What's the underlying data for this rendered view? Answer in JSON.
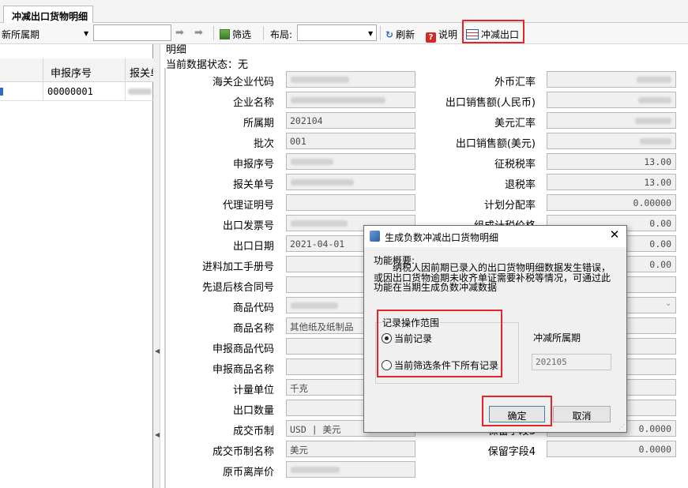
{
  "tab": {
    "label": "冲减出口货物明细"
  },
  "toolbar": {
    "period_label": "所属期",
    "period_value": "",
    "filter_input_value": "",
    "filter_label": "筛选",
    "layout_label": "布局:",
    "layout_value": "",
    "refresh_label": "刷新",
    "help_label": "说明",
    "offset_export_label": "冲减出口"
  },
  "grid": {
    "columns": [
      "申报序号",
      "报关单"
    ],
    "rows": [
      {
        "seq": "00000001"
      }
    ]
  },
  "form": {
    "section_title": "明细",
    "status_label": "当前数据状态：无",
    "left_fields": [
      {
        "label": "海关企业代码",
        "value": ""
      },
      {
        "label": "企业名称",
        "value": ""
      },
      {
        "label": "所属期",
        "value": "202104"
      },
      {
        "label": "批次",
        "value": "001"
      },
      {
        "label": "申报序号",
        "value": ""
      },
      {
        "label": "报关单号",
        "value": ""
      },
      {
        "label": "代理证明号",
        "value": ""
      },
      {
        "label": "出口发票号",
        "value": ""
      },
      {
        "label": "出口日期",
        "value": "2021-04-01"
      },
      {
        "label": "进料加工手册号",
        "value": ""
      },
      {
        "label": "先退后核合同号",
        "value": ""
      },
      {
        "label": "商品代码",
        "value": ""
      },
      {
        "label": "商品名称",
        "value": "其他纸及纸制品"
      },
      {
        "label": "申报商品代码",
        "value": ""
      },
      {
        "label": "申报商品名称",
        "value": ""
      },
      {
        "label": "计量单位",
        "value": "千克"
      },
      {
        "label": "出口数量",
        "value": ""
      },
      {
        "label": "成交币制",
        "value": "USD | 美元"
      },
      {
        "label": "成交币制名称",
        "value": "美元"
      },
      {
        "label": "原币离岸价",
        "value": ""
      }
    ],
    "right_fields": [
      {
        "label": "外币汇率",
        "value": ""
      },
      {
        "label": "出口销售额(人民币)",
        "value": ""
      },
      {
        "label": "美元汇率",
        "value": ""
      },
      {
        "label": "出口销售额(美元)",
        "value": ""
      },
      {
        "label": "征税税率",
        "value": "13.00"
      },
      {
        "label": "退税率",
        "value": "13.00"
      },
      {
        "label": "计划分配率",
        "value": "0.00000"
      },
      {
        "label": "组成计税价格",
        "value": "0.00"
      },
      {
        "label": "",
        "value": "0.00"
      },
      {
        "label": "",
        "value": "0.00"
      },
      {
        "label": "",
        "value": ""
      },
      {
        "label": "",
        "value": ""
      },
      {
        "label": "",
        "value": ""
      },
      {
        "label": "",
        "value": ""
      },
      {
        "label": "",
        "value": ""
      },
      {
        "label": "",
        "value": ""
      },
      {
        "label": "",
        "value": ""
      },
      {
        "label": "保留字段3",
        "value": "0.0000"
      },
      {
        "label": "保留字段4",
        "value": "0.0000"
      }
    ]
  },
  "dialog": {
    "title": "生成负数冲减出口货物明细",
    "close": "✕",
    "summary_title": "功能概要:",
    "summary_text": "纳税人因前期已录入的出口货物明细数据发生错误，或因出口货物逾期未收齐单证需要补税等情况，可通过此功能在当期生成负数冲减数据",
    "range_group_title": "记录操作范围",
    "option_current": "当前记录",
    "option_all": "当前筛选条件下所有记录",
    "selected_option": "current",
    "offset_period_label": "冲减所属期",
    "offset_period_value": "202105",
    "ok_label": "确定",
    "cancel_label": "取消"
  },
  "colors": {
    "highlight_red": "#e4262a"
  }
}
